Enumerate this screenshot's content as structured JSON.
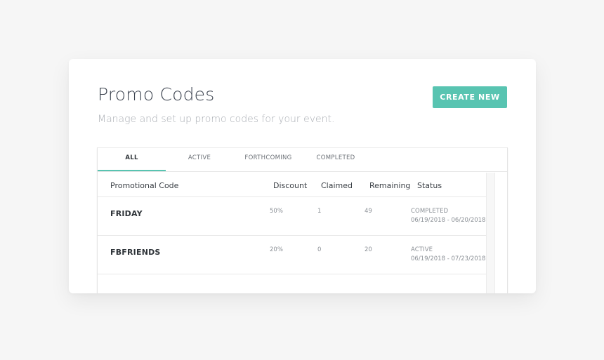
{
  "page": {
    "title": "Promo Codes",
    "subtitle": "Manage and set up promo codes for your event.",
    "create_button": "CREATE NEW"
  },
  "tabs": [
    {
      "label": "ALL",
      "active": true
    },
    {
      "label": "ACTIVE",
      "active": false
    },
    {
      "label": "FORTHCOMING",
      "active": false
    },
    {
      "label": "COMPLETED",
      "active": false
    }
  ],
  "table": {
    "headers": {
      "code": "Promotional Code",
      "discount": "Discount",
      "claimed": "Claimed",
      "remaining": "Remaining",
      "status": "Status"
    },
    "rows": [
      {
        "code": "FRIDAY",
        "discount": "50%",
        "claimed": "1",
        "remaining": "49",
        "status": "COMPLETED",
        "dates": "06/19/2018 - 06/20/2018"
      },
      {
        "code": "FBFRIENDS",
        "discount": "20%",
        "claimed": "0",
        "remaining": "20",
        "status": "ACTIVE",
        "dates": "06/19/2018 - 07/23/2018"
      }
    ]
  },
  "colors": {
    "accent": "#58c4b1",
    "background": "#f6f6f6"
  }
}
